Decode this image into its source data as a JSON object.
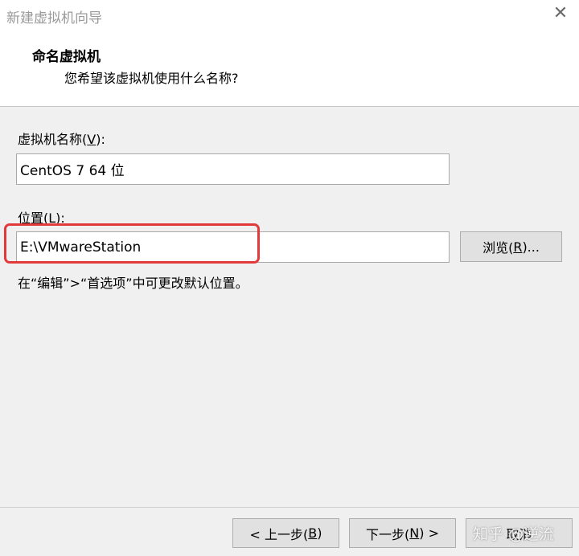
{
  "window": {
    "title": "新建虚拟机向导",
    "close_glyph": "✕"
  },
  "header": {
    "title": "命名虚拟机",
    "subtitle": "您希望该虚拟机使用什么名称?"
  },
  "vm_name": {
    "label_prefix": "虚拟机名称(",
    "label_mnemonic": "V",
    "label_suffix": "):",
    "value": "CentOS 7 64 位"
  },
  "location": {
    "label_prefix": "位置(",
    "label_mnemonic": "L",
    "label_suffix": "):",
    "value": "E:\\VMwareStation",
    "browse_prefix": "浏览(",
    "browse_mnemonic": "R",
    "browse_suffix": ")...",
    "hint": "在“编辑”>“首选项”中可更改默认位置。"
  },
  "footer": {
    "back_prefix": "< 上一步(",
    "back_mnemonic": "B",
    "back_suffix": ")",
    "next_prefix": "下一步(",
    "next_mnemonic": "N",
    "next_suffix": ") >",
    "cancel_label": "取消"
  },
  "watermark": "知乎 @逆流",
  "colors": {
    "highlight": "#e23a3a",
    "dialog_bg": "#f0f0f0",
    "header_bg": "#ffffff"
  }
}
